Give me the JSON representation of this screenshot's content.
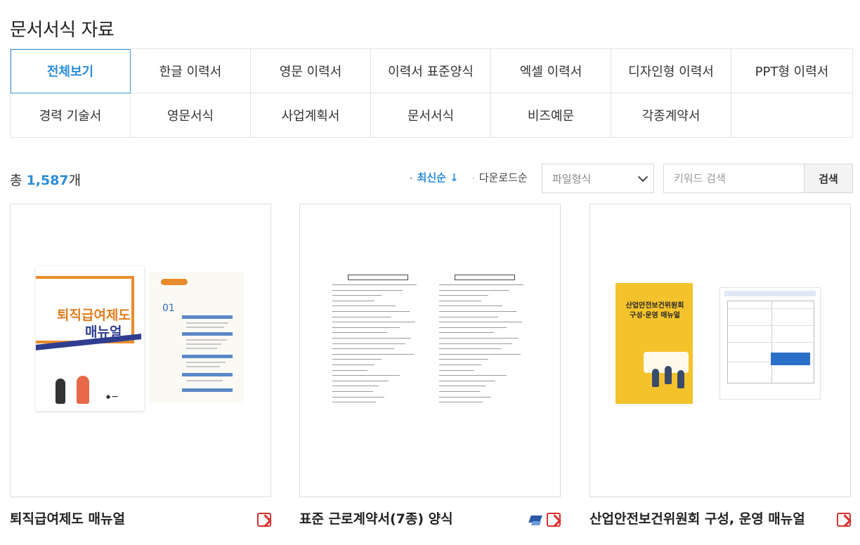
{
  "page": {
    "title": "문서서식 자료"
  },
  "categories": [
    {
      "label": "전체보기",
      "active": true
    },
    {
      "label": "한글 이력서"
    },
    {
      "label": "영문 이력서"
    },
    {
      "label": "이력서 표준양식"
    },
    {
      "label": "엑셀 이력서"
    },
    {
      "label": "디자인형 이력서"
    },
    {
      "label": "PPT형 이력서"
    },
    {
      "label": "경력 기술서"
    },
    {
      "label": "영문서식"
    },
    {
      "label": "사업계획서"
    },
    {
      "label": "문서서식"
    },
    {
      "label": "비즈예문"
    },
    {
      "label": "각종계약서"
    }
  ],
  "toolbar": {
    "total_prefix": "총",
    "total_count": "1,587",
    "total_suffix": "개",
    "sort_latest": "최신순 ↓",
    "sort_download": "다운로드순",
    "filetype_selected": "파일형식",
    "search_placeholder": "키워드 검색",
    "search_button": "검색"
  },
  "cards": [
    {
      "title": "퇴직급여제도 매뉴얼",
      "file_icons": [
        "pdf-icon"
      ],
      "thumb_heading_1": "퇴직급여제도",
      "thumb_heading_2": "매뉴얼",
      "thumb_number": "01"
    },
    {
      "title": "표준 근로계약서(7종) 양식",
      "file_icons": [
        "hwp-icon",
        "pdf-icon"
      ]
    },
    {
      "title": "산업안전보건위원회 구성, 운영 매뉴얼",
      "file_icons": [
        "pdf-icon"
      ],
      "thumb_heading": "산업안전보건위원회 구성·운영 매뉴얼"
    }
  ],
  "colors": {
    "accent": "#2b8ed8",
    "border": "#e3e3e3",
    "pdf": "#d9302e"
  }
}
